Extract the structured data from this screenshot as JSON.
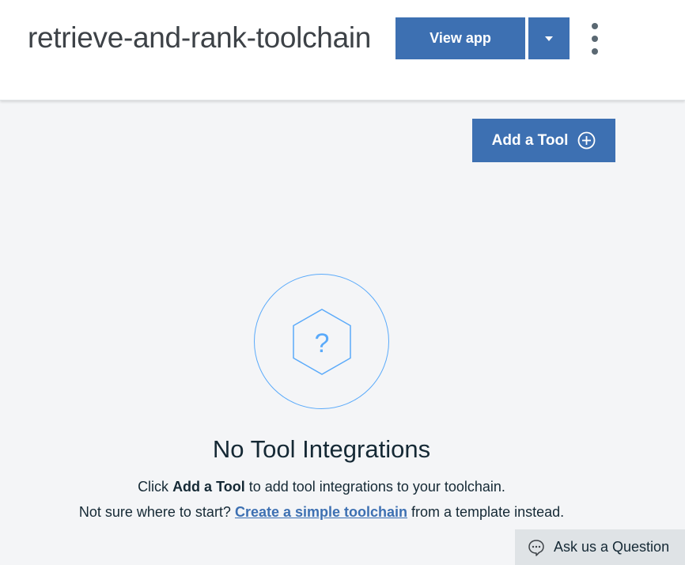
{
  "header": {
    "title": "retrieve-and-rank-toolchain",
    "view_app_label": "View app",
    "dropdown_icon": "caret-down-icon",
    "menu_icon": "kebab-menu-icon"
  },
  "toolbar": {
    "add_tool_label": "Add a Tool",
    "add_tool_icon": "plus-circle-icon"
  },
  "empty_state": {
    "icon": "question-hexagon-icon",
    "title": "No Tool Integrations",
    "line1_prefix": "Click ",
    "line1_bold": "Add a Tool",
    "line1_suffix": " to add tool integrations to your toolchain.",
    "line2_prefix": "Not sure where to start? ",
    "line2_link": "Create a simple toolchain",
    "line2_suffix": " from a template instead."
  },
  "help": {
    "label": "Ask us a Question",
    "icon": "chat-bubble-icon"
  },
  "colors": {
    "primary": "#3d70b2",
    "accent": "#5aaafa",
    "background": "#f4f5f7"
  }
}
